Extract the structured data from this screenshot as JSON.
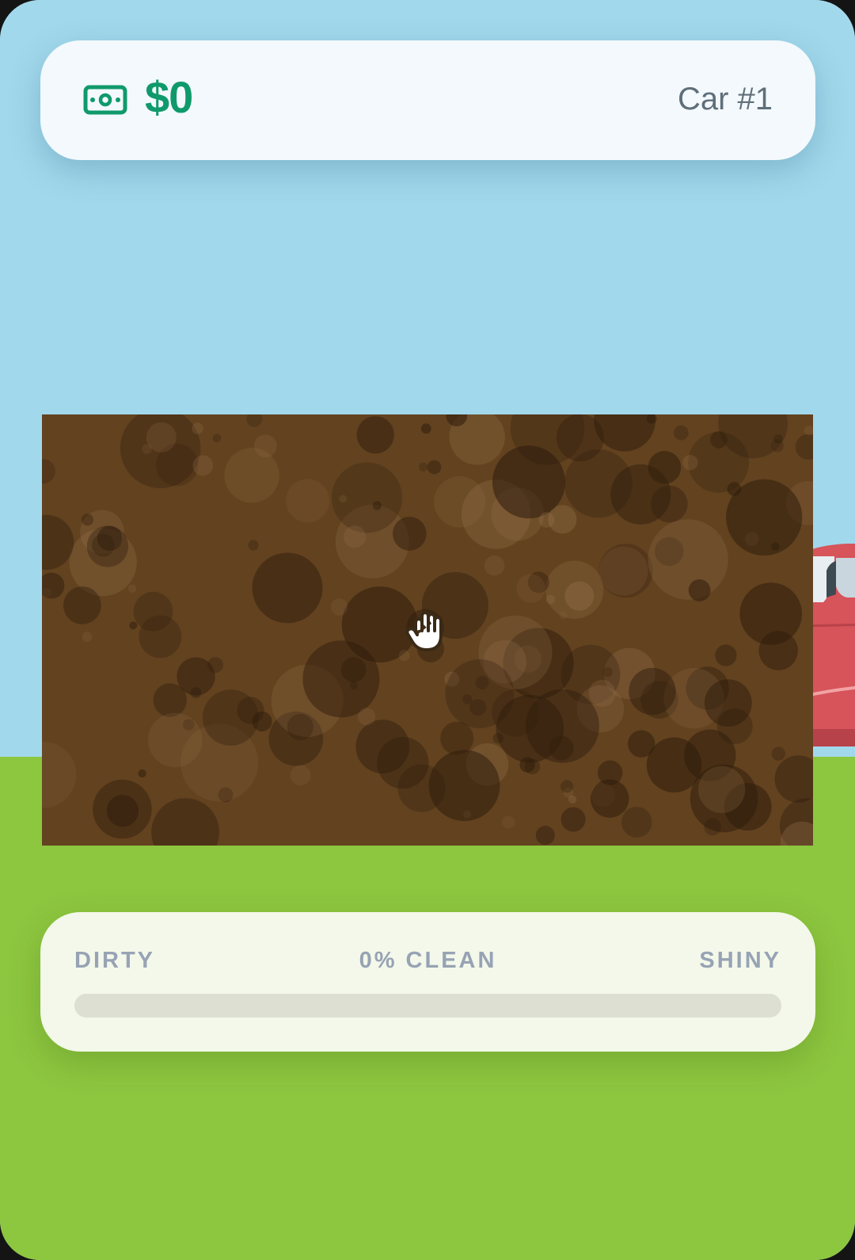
{
  "header": {
    "money_icon": "money-bill-icon",
    "money": "$0",
    "car_label": "Car #1"
  },
  "wash_area": {
    "cursor_icon": "grab-hand-icon"
  },
  "progress": {
    "left_label": "DIRTY",
    "center_label": "0% CLEAN",
    "right_label": "SHINY",
    "clean_fraction": 0
  },
  "colors": {
    "sky": "#a2d8ec",
    "grass": "#8dc63f",
    "money_green": "#109a6b",
    "dirt": "#62421f",
    "car_red": "#d6545a"
  }
}
